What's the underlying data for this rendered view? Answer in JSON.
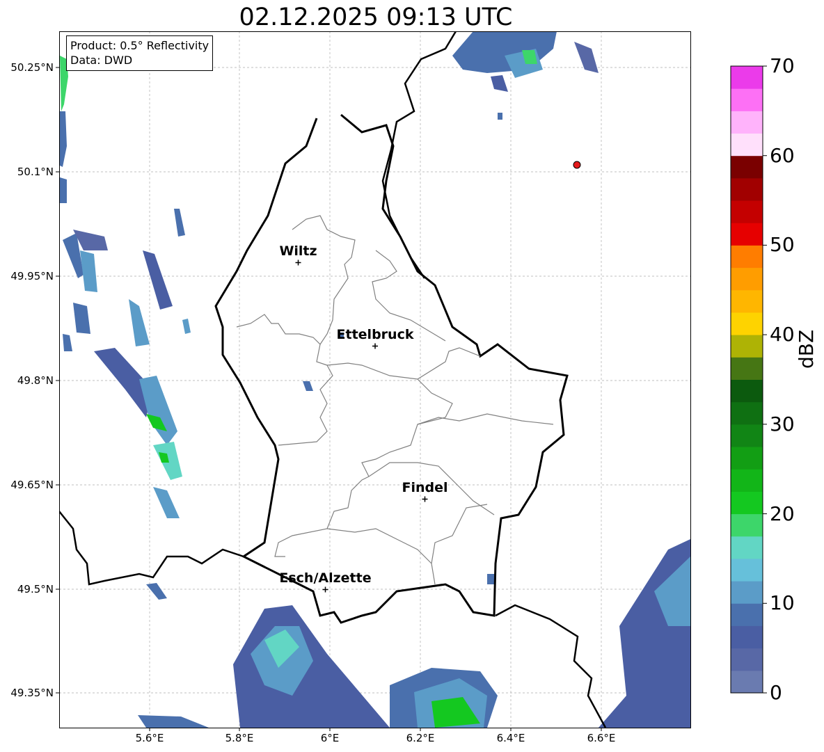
{
  "title": "02.12.2025 09:13 UTC",
  "info": {
    "line1": "Product: 0.5° Reflectivity",
    "line2": "Data: DWD"
  },
  "axes": {
    "x_ticks": [
      "5.6°E",
      "5.8°E",
      "6°E",
      "6.2°E",
      "6.4°E",
      "6.6°E"
    ],
    "y_ticks": [
      "50.25°N",
      "50.1°N",
      "49.95°N",
      "49.8°N",
      "49.65°N",
      "49.5°N",
      "49.35°N"
    ]
  },
  "cities": [
    {
      "name": "Wiltz",
      "lon": 5.93,
      "lat": 49.97
    },
    {
      "name": "Ettelbruck",
      "lon": 6.1,
      "lat": 49.85
    },
    {
      "name": "Findel",
      "lon": 6.21,
      "lat": 49.63
    },
    {
      "name": "Esch/Alzette",
      "lon": 5.99,
      "lat": 49.5
    }
  ],
  "marker": {
    "lon": 6.55,
    "lat": 50.11,
    "color": "#e41a1c"
  },
  "colorbar": {
    "unit": "dBZ",
    "labels": [
      "70",
      "60",
      "50",
      "40",
      "30",
      "20",
      "10",
      "0"
    ],
    "colors": [
      "#6a7bb0",
      "#5868a6",
      "#4a5ea3",
      "#4a70ad",
      "#5b9cc8",
      "#66c0da",
      "#62d6c4",
      "#3dd66a",
      "#14c820",
      "#12b518",
      "#129e14",
      "#118515",
      "#0f7012",
      "#0c5a0e",
      "#467614",
      "#aeb305",
      "#fed300",
      "#ffb600",
      "#ff9d00",
      "#ff7d00",
      "#e60000",
      "#c40000",
      "#a10000",
      "#7a0000",
      "#ffe0fb",
      "#ffb3fb",
      "#fd70f5",
      "#eb3bea"
    ]
  }
}
